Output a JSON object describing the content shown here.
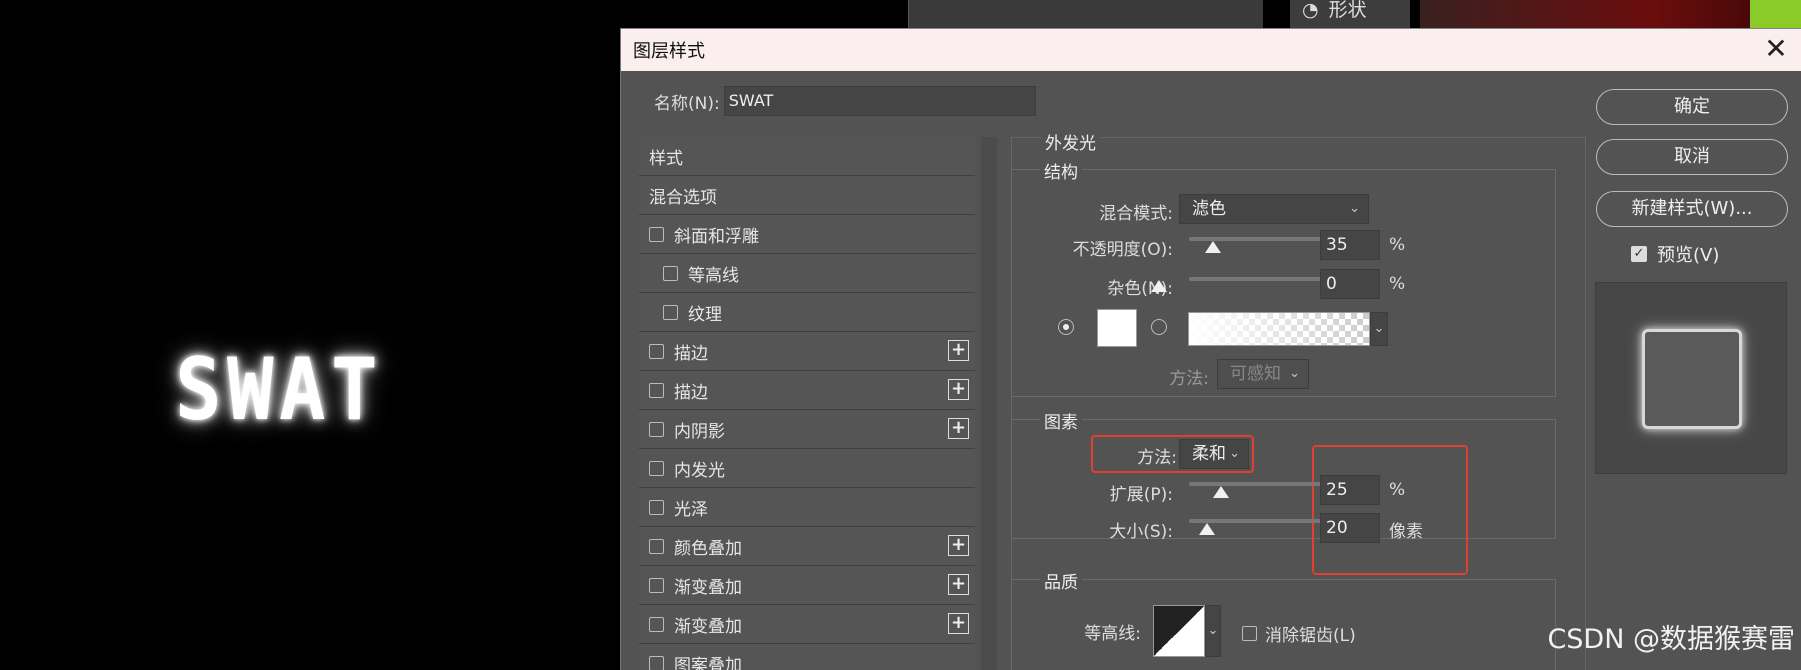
{
  "canvas": {
    "text": "SWAT"
  },
  "top_strip": {
    "shape_label": "形状"
  },
  "dialog": {
    "title": "图层样式",
    "name_label": "名称(N):",
    "name_value": "SWAT"
  },
  "styles_list": {
    "items": [
      {
        "label": "样式",
        "checkbox": false,
        "plus": false,
        "indent": 0
      },
      {
        "label": "混合选项",
        "checkbox": false,
        "plus": false,
        "indent": 0
      },
      {
        "label": "斜面和浮雕",
        "checkbox": true,
        "plus": false,
        "indent": 0
      },
      {
        "label": "等高线",
        "checkbox": true,
        "plus": false,
        "indent": 1
      },
      {
        "label": "纹理",
        "checkbox": true,
        "plus": false,
        "indent": 1
      },
      {
        "label": "描边",
        "checkbox": true,
        "plus": true,
        "indent": 0
      },
      {
        "label": "描边",
        "checkbox": true,
        "plus": true,
        "indent": 0
      },
      {
        "label": "内阴影",
        "checkbox": true,
        "plus": true,
        "indent": 0
      },
      {
        "label": "内发光",
        "checkbox": true,
        "plus": false,
        "indent": 0
      },
      {
        "label": "光泽",
        "checkbox": true,
        "plus": false,
        "indent": 0
      },
      {
        "label": "颜色叠加",
        "checkbox": true,
        "plus": true,
        "indent": 0
      },
      {
        "label": "渐变叠加",
        "checkbox": true,
        "plus": true,
        "indent": 0
      },
      {
        "label": "渐变叠加",
        "checkbox": true,
        "plus": true,
        "indent": 0
      },
      {
        "label": "图案叠加",
        "checkbox": true,
        "plus": false,
        "indent": 0
      }
    ]
  },
  "outer_glow": {
    "title": "外发光",
    "structure": {
      "title": "结构",
      "blend_mode_label": "混合模式:",
      "blend_mode_value": "滤色",
      "opacity_label": "不透明度(O):",
      "opacity_value": "35",
      "opacity_unit": "%",
      "noise_label": "杂色(N):",
      "noise_value": "0",
      "noise_unit": "%",
      "method_label": "方法:",
      "method_value": "可感知"
    },
    "elements": {
      "title": "图素",
      "method_label": "方法:",
      "method_value": "柔和",
      "spread_label": "扩展(P):",
      "spread_value": "25",
      "spread_unit": "%",
      "size_label": "大小(S):",
      "size_value": "20",
      "size_unit": "像素"
    },
    "quality": {
      "title": "品质",
      "contour_label": "等高线:",
      "anti_alias_label": "消除锯齿(L)"
    }
  },
  "buttons": {
    "ok": "确定",
    "cancel": "取消",
    "new_style": "新建样式(W)...",
    "preview": "预览(V)"
  },
  "watermark": "CSDN @数据猴赛雷",
  "colors": {
    "highlight": "#e04030",
    "dialog_bg": "#535353",
    "titlebar_bg": "#faeeee"
  }
}
